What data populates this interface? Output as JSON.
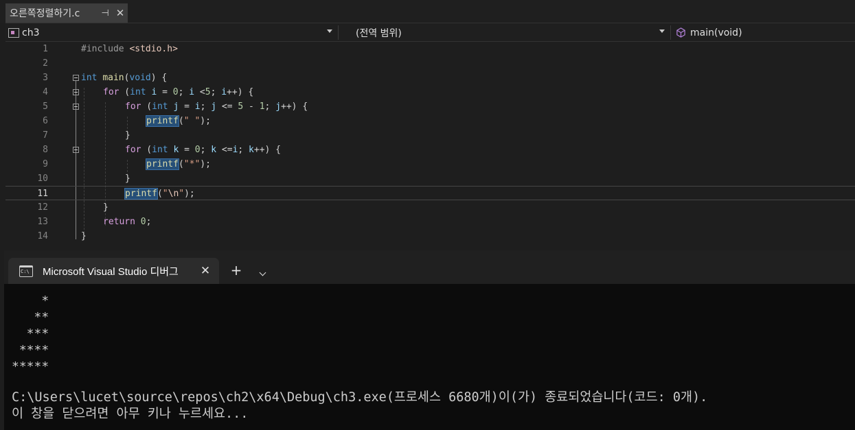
{
  "editor_tab": {
    "title": "오른쪽정렬하기.c",
    "pin_icon": "pin-icon",
    "close_icon": "close-icon"
  },
  "navbar": {
    "project": "ch3",
    "scope": "(전역 범위)",
    "member": "main(void)"
  },
  "code_lines": [
    {
      "num": "1"
    },
    {
      "num": "2"
    },
    {
      "num": "3"
    },
    {
      "num": "4"
    },
    {
      "num": "5"
    },
    {
      "num": "6"
    },
    {
      "num": "7"
    },
    {
      "num": "8"
    },
    {
      "num": "9"
    },
    {
      "num": "10"
    },
    {
      "num": "11"
    },
    {
      "num": "12"
    },
    {
      "num": "13"
    },
    {
      "num": "14"
    }
  ],
  "code": {
    "l1_pp": "#include ",
    "l1_inc": "<stdio.h>",
    "l3_kw": "int",
    "l3_fn": "main",
    "l3_p1": "(",
    "l3_void": "void",
    "l3_p2": ") {",
    "l4_for": "for",
    "l4_a": " (",
    "l4_int": "int",
    "l4_b": " ",
    "l4_i1": "i",
    "l4_c": " = ",
    "l4_n0": "0",
    "l4_d": "; ",
    "l4_i2": "i",
    "l4_e": " <",
    "l4_n5": "5",
    "l4_f": "; ",
    "l4_i3": "i",
    "l4_g": "++) {",
    "l5_for": "for",
    "l5_a": " (",
    "l5_int": "int",
    "l5_b": " ",
    "l5_j1": "j",
    "l5_c": " = ",
    "l5_i": "i",
    "l5_d": "; ",
    "l5_j2": "j",
    "l5_e": " <= ",
    "l5_n5": "5",
    "l5_f": " - ",
    "l5_n1": "1",
    "l5_g": "; ",
    "l5_j3": "j",
    "l5_h": "++) {",
    "l6_fn": "printf",
    "l6_a": "(",
    "l6_s": "\" \"",
    "l6_b": ");",
    "l7": "}",
    "l8_for": "for",
    "l8_a": " (",
    "l8_int": "int",
    "l8_b": " ",
    "l8_k1": "k",
    "l8_c": " = ",
    "l8_n0": "0",
    "l8_d": "; ",
    "l8_k2": "k",
    "l8_e": " <=",
    "l8_i": "i",
    "l8_f": "; ",
    "l8_k3": "k",
    "l8_g": "++) {",
    "l9_fn": "printf",
    "l9_a": "(",
    "l9_s": "\"*\"",
    "l9_b": ");",
    "l10": "}",
    "l11_fn": "printf",
    "l11_a": "(",
    "l11_q1": "\"",
    "l11_esc": "\\n",
    "l11_q2": "\"",
    "l11_b": ");",
    "l12": "}",
    "l13_ret": "return",
    "l13_sp": " ",
    "l13_n": "0",
    "l13_b": ";",
    "l14": "}"
  },
  "terminal": {
    "tab_label": "Microsoft Visual Studio 디버그",
    "tab_icon_text": "C:\\",
    "output_lines": [
      "    *",
      "   **",
      "  ***",
      " ****",
      "*****"
    ],
    "exit_message": "C:\\Users\\lucet\\source\\repos\\ch2\\x64\\Debug\\ch3.exe(프로세스 6680개)이(가) 종료되었습니다(코드: 0개).",
    "close_prompt": "이 창을 닫으려면 아무 키나 누르세요..."
  },
  "colors": {
    "editor_bg": "#1e1e1e",
    "terminal_bg": "#0c0c0c",
    "keyword": "#569cd6",
    "control": "#d8a0df",
    "function": "#dcdcaa",
    "string": "#d69d85",
    "number": "#b5cea8",
    "variable": "#9cdcfe"
  }
}
